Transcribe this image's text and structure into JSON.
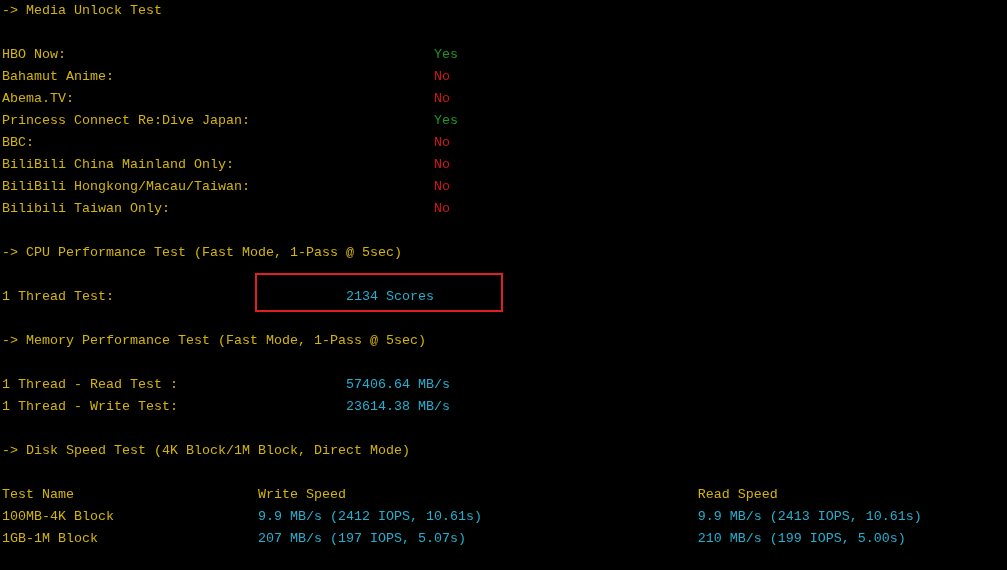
{
  "media": {
    "title": "-> Media Unlock Test",
    "rows": [
      {
        "label": "HBO Now:",
        "result": "Yes",
        "unlocked": true
      },
      {
        "label": "Bahamut Anime:",
        "result": "No",
        "unlocked": false
      },
      {
        "label": "Abema.TV:",
        "result": "No",
        "unlocked": false
      },
      {
        "label": "Princess Connect Re:Dive Japan:",
        "result": "Yes",
        "unlocked": true
      },
      {
        "label": "BBC:",
        "result": "No",
        "unlocked": false
      },
      {
        "label": "BiliBili China Mainland Only:",
        "result": "No",
        "unlocked": false
      },
      {
        "label": "BiliBili Hongkong/Macau/Taiwan:",
        "result": "No",
        "unlocked": false
      },
      {
        "label": "Bilibili Taiwan Only:",
        "result": "No",
        "unlocked": false
      }
    ]
  },
  "cpu": {
    "title": "-> CPU Performance Test (Fast Mode, 1-Pass @ 5sec)",
    "rows": [
      {
        "label": "1 Thread Test:",
        "value": "2134 Scores",
        "highlighted": true
      }
    ]
  },
  "memory": {
    "title": "-> Memory Performance Test (Fast Mode, 1-Pass @ 5sec)",
    "rows": [
      {
        "label": "1 Thread - Read Test :",
        "value": "57406.64 MB/s",
        "highlighted": false
      },
      {
        "label": "1 Thread - Write Test:",
        "value": "23614.38 MB/s",
        "highlighted": false
      }
    ]
  },
  "disk": {
    "title": "-> Disk Speed Test (4K Block/1M Block, Direct Mode)",
    "columns": [
      "Test Name",
      "Write Speed",
      "Read Speed"
    ],
    "rows": [
      {
        "name": "100MB-4K Block",
        "write": "9.9 MB/s (2412 IOPS, 10.61s)",
        "read": "9.9 MB/s (2413 IOPS, 10.61s)"
      },
      {
        "name": "1GB-1M Block",
        "write": "207 MB/s (197 IOPS, 5.07s)",
        "read": "210 MB/s (199 IOPS, 5.00s)"
      }
    ]
  }
}
